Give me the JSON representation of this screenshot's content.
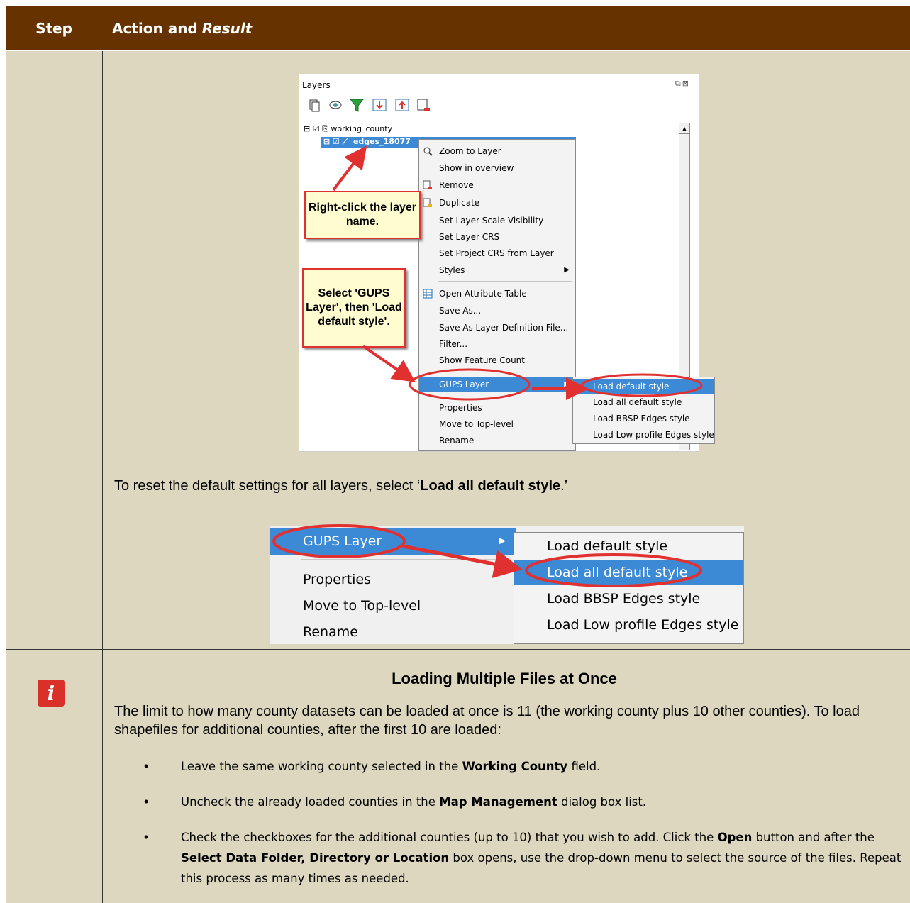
{
  "header": {
    "step": "Step",
    "action": "Action and",
    "result": "Result",
    "bg_color": "#663300"
  },
  "shot1": {
    "panel_title": "Layers",
    "tree": {
      "group": "working_county",
      "layer": "edges_18077"
    },
    "menu": [
      "Zoom to Layer",
      "Show in overview",
      "Remove",
      "Duplicate",
      "Set Layer Scale Visibility",
      "Set Layer CRS",
      "Set Project CRS from Layer",
      "Styles",
      "Open Attribute Table",
      "Save As...",
      "Save As Layer Definition File...",
      "Filter...",
      "Show Feature Count",
      "GUPS Layer",
      "Properties",
      "Move to Top-level",
      "Rename"
    ],
    "submenu": [
      "Load default style",
      "Load all default style",
      "Load BBSP Edges style",
      "Load Low profile Edges style"
    ],
    "callout1": "Right-click the layer name.",
    "callout2": "Select 'GUPS Layer', then 'Load default style'."
  },
  "para": {
    "pre": "To reset the default settings for all layers, select ‘",
    "bold": "Load all default style",
    "post": ".’"
  },
  "shot2": {
    "menu": [
      "GUPS Layer",
      "Properties",
      "Move to Top-level",
      "Rename"
    ],
    "submenu": [
      "Load default style",
      "Load all default style",
      "Load BBSP Edges style",
      "Load Low profile Edges style"
    ]
  },
  "note": {
    "heading": "Loading Multiple Files at Once",
    "intro": "The limit to how many county datasets can be loaded at once is 11 (the working county plus 10 other counties). To load shapefiles for additional counties, after the first 10 are loaded:",
    "b1": {
      "a": "Leave the same working county selected in the ",
      "b": "Working County",
      "c": " field."
    },
    "b2": {
      "a": "Uncheck the already loaded counties in the ",
      "b": "Map Management",
      "c": " dialog box list."
    },
    "b3": {
      "a": "Check the checkboxes for the additional counties (up to 10) that you wish to add. Click the ",
      "b": "Open",
      "c": " button and after the ",
      "d": "Select Data Folder, Directory or Location",
      "e": " box opens, use the drop-down menu to select the source of the files. Repeat this process as many times as needed."
    }
  }
}
